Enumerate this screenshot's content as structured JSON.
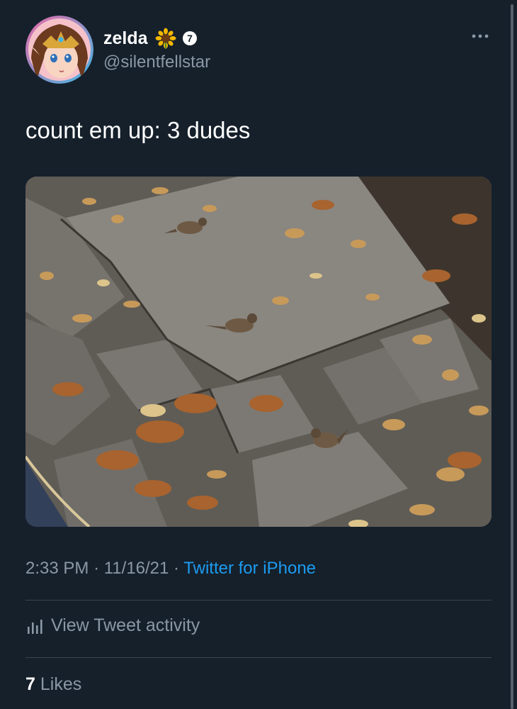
{
  "tweet": {
    "display_name": "zelda",
    "name_emoji_icon": "sunflower-icon",
    "badge_icon": "number-7-badge-icon",
    "badge_text": "7",
    "handle": "@silentfellstar",
    "more_icon": "more-options-icon",
    "text": "count em up: 3 dudes",
    "photo_alt": "",
    "time": "2:33 PM",
    "sep1": "·",
    "date": "11/16/21",
    "sep2": "·",
    "source": "Twitter for iPhone",
    "activity_label": "View Tweet activity",
    "activity_icon": "bar-chart-icon",
    "likes_count": "7",
    "likes_label": "Likes"
  },
  "colors": {
    "background": "#15202b",
    "link": "#1d9bf0",
    "secondary_text": "#8b98a5",
    "divider": "#38444d"
  }
}
